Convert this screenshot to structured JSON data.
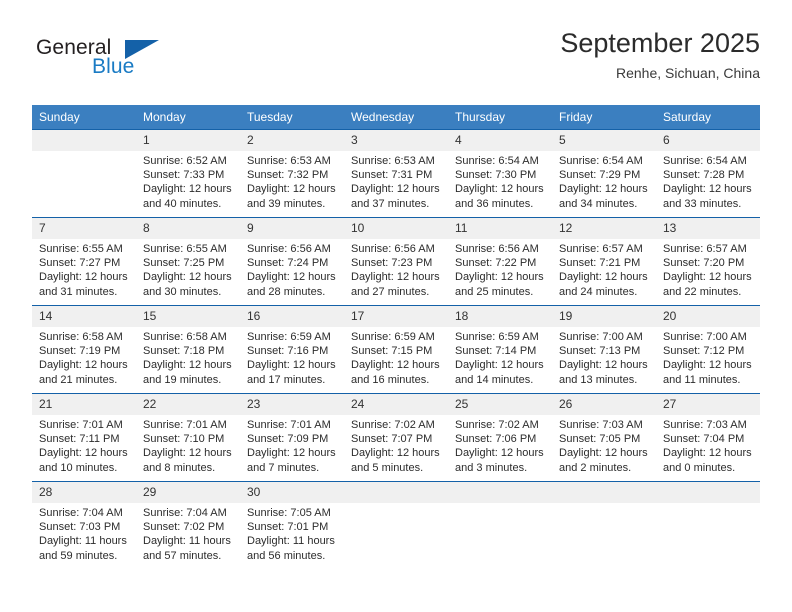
{
  "brand": {
    "name_top": "General",
    "name_bottom": "Blue",
    "accent_color": "#1461a8",
    "text_color": "#1a7bc4"
  },
  "header": {
    "title": "September 2025",
    "subtitle": "Renhe, Sichuan, China"
  },
  "theme": {
    "header_bg": "#3b7fc0",
    "rule_color": "#1461a8",
    "daynum_bg": "#f0f0f0"
  },
  "weekdays": [
    "Sunday",
    "Monday",
    "Tuesday",
    "Wednesday",
    "Thursday",
    "Friday",
    "Saturday"
  ],
  "weeks": [
    [
      {
        "day": "",
        "lines": []
      },
      {
        "day": "1",
        "lines": [
          "Sunrise: 6:52 AM",
          "Sunset: 7:33 PM",
          "Daylight: 12 hours",
          "and 40 minutes."
        ]
      },
      {
        "day": "2",
        "lines": [
          "Sunrise: 6:53 AM",
          "Sunset: 7:32 PM",
          "Daylight: 12 hours",
          "and 39 minutes."
        ]
      },
      {
        "day": "3",
        "lines": [
          "Sunrise: 6:53 AM",
          "Sunset: 7:31 PM",
          "Daylight: 12 hours",
          "and 37 minutes."
        ]
      },
      {
        "day": "4",
        "lines": [
          "Sunrise: 6:54 AM",
          "Sunset: 7:30 PM",
          "Daylight: 12 hours",
          "and 36 minutes."
        ]
      },
      {
        "day": "5",
        "lines": [
          "Sunrise: 6:54 AM",
          "Sunset: 7:29 PM",
          "Daylight: 12 hours",
          "and 34 minutes."
        ]
      },
      {
        "day": "6",
        "lines": [
          "Sunrise: 6:54 AM",
          "Sunset: 7:28 PM",
          "Daylight: 12 hours",
          "and 33 minutes."
        ]
      }
    ],
    [
      {
        "day": "7",
        "lines": [
          "Sunrise: 6:55 AM",
          "Sunset: 7:27 PM",
          "Daylight: 12 hours",
          "and 31 minutes."
        ]
      },
      {
        "day": "8",
        "lines": [
          "Sunrise: 6:55 AM",
          "Sunset: 7:25 PM",
          "Daylight: 12 hours",
          "and 30 minutes."
        ]
      },
      {
        "day": "9",
        "lines": [
          "Sunrise: 6:56 AM",
          "Sunset: 7:24 PM",
          "Daylight: 12 hours",
          "and 28 minutes."
        ]
      },
      {
        "day": "10",
        "lines": [
          "Sunrise: 6:56 AM",
          "Sunset: 7:23 PM",
          "Daylight: 12 hours",
          "and 27 minutes."
        ]
      },
      {
        "day": "11",
        "lines": [
          "Sunrise: 6:56 AM",
          "Sunset: 7:22 PM",
          "Daylight: 12 hours",
          "and 25 minutes."
        ]
      },
      {
        "day": "12",
        "lines": [
          "Sunrise: 6:57 AM",
          "Sunset: 7:21 PM",
          "Daylight: 12 hours",
          "and 24 minutes."
        ]
      },
      {
        "day": "13",
        "lines": [
          "Sunrise: 6:57 AM",
          "Sunset: 7:20 PM",
          "Daylight: 12 hours",
          "and 22 minutes."
        ]
      }
    ],
    [
      {
        "day": "14",
        "lines": [
          "Sunrise: 6:58 AM",
          "Sunset: 7:19 PM",
          "Daylight: 12 hours",
          "and 21 minutes."
        ]
      },
      {
        "day": "15",
        "lines": [
          "Sunrise: 6:58 AM",
          "Sunset: 7:18 PM",
          "Daylight: 12 hours",
          "and 19 minutes."
        ]
      },
      {
        "day": "16",
        "lines": [
          "Sunrise: 6:59 AM",
          "Sunset: 7:16 PM",
          "Daylight: 12 hours",
          "and 17 minutes."
        ]
      },
      {
        "day": "17",
        "lines": [
          "Sunrise: 6:59 AM",
          "Sunset: 7:15 PM",
          "Daylight: 12 hours",
          "and 16 minutes."
        ]
      },
      {
        "day": "18",
        "lines": [
          "Sunrise: 6:59 AM",
          "Sunset: 7:14 PM",
          "Daylight: 12 hours",
          "and 14 minutes."
        ]
      },
      {
        "day": "19",
        "lines": [
          "Sunrise: 7:00 AM",
          "Sunset: 7:13 PM",
          "Daylight: 12 hours",
          "and 13 minutes."
        ]
      },
      {
        "day": "20",
        "lines": [
          "Sunrise: 7:00 AM",
          "Sunset: 7:12 PM",
          "Daylight: 12 hours",
          "and 11 minutes."
        ]
      }
    ],
    [
      {
        "day": "21",
        "lines": [
          "Sunrise: 7:01 AM",
          "Sunset: 7:11 PM",
          "Daylight: 12 hours",
          "and 10 minutes."
        ]
      },
      {
        "day": "22",
        "lines": [
          "Sunrise: 7:01 AM",
          "Sunset: 7:10 PM",
          "Daylight: 12 hours",
          "and 8 minutes."
        ]
      },
      {
        "day": "23",
        "lines": [
          "Sunrise: 7:01 AM",
          "Sunset: 7:09 PM",
          "Daylight: 12 hours",
          "and 7 minutes."
        ]
      },
      {
        "day": "24",
        "lines": [
          "Sunrise: 7:02 AM",
          "Sunset: 7:07 PM",
          "Daylight: 12 hours",
          "and 5 minutes."
        ]
      },
      {
        "day": "25",
        "lines": [
          "Sunrise: 7:02 AM",
          "Sunset: 7:06 PM",
          "Daylight: 12 hours",
          "and 3 minutes."
        ]
      },
      {
        "day": "26",
        "lines": [
          "Sunrise: 7:03 AM",
          "Sunset: 7:05 PM",
          "Daylight: 12 hours",
          "and 2 minutes."
        ]
      },
      {
        "day": "27",
        "lines": [
          "Sunrise: 7:03 AM",
          "Sunset: 7:04 PM",
          "Daylight: 12 hours",
          "and 0 minutes."
        ]
      }
    ],
    [
      {
        "day": "28",
        "lines": [
          "Sunrise: 7:04 AM",
          "Sunset: 7:03 PM",
          "Daylight: 11 hours",
          "and 59 minutes."
        ]
      },
      {
        "day": "29",
        "lines": [
          "Sunrise: 7:04 AM",
          "Sunset: 7:02 PM",
          "Daylight: 11 hours",
          "and 57 minutes."
        ]
      },
      {
        "day": "30",
        "lines": [
          "Sunrise: 7:05 AM",
          "Sunset: 7:01 PM",
          "Daylight: 11 hours",
          "and 56 minutes."
        ]
      },
      {
        "day": "",
        "lines": []
      },
      {
        "day": "",
        "lines": []
      },
      {
        "day": "",
        "lines": []
      },
      {
        "day": "",
        "lines": []
      }
    ]
  ]
}
